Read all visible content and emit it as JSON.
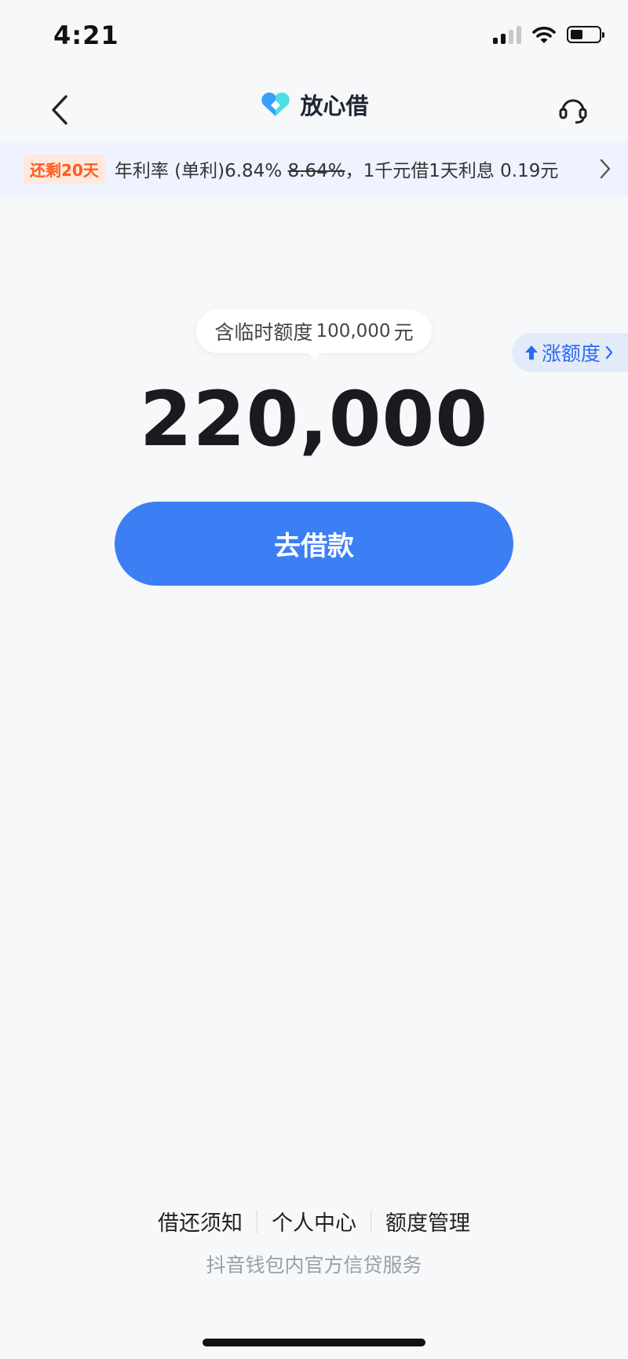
{
  "status_bar": {
    "time": "4:21",
    "battery_level": 0.45
  },
  "nav": {
    "brand_name": "放心借",
    "brand_colors": {
      "left": "#3aa0ff",
      "right": "#4be0e6",
      "center": "#ffffff"
    }
  },
  "promo": {
    "tag": "还剩20天",
    "rate_prefix": "年利率 (单利)",
    "rate_current": "6.84%",
    "rate_original": "8.64%",
    "rate_suffix": "，1千元借1天利息 0.19元"
  },
  "credit": {
    "temp_prefix": "含临时额度",
    "temp_amount": "100,000",
    "temp_unit": "元",
    "amount": "220,000",
    "raise_label": "涨额度"
  },
  "actions": {
    "borrow_label": "去借款"
  },
  "footer": {
    "links": [
      "借还须知",
      "个人中心",
      "额度管理"
    ],
    "note": "抖音钱包内官方信贷服务"
  },
  "colors": {
    "accent": "#3c7ff5",
    "promo_tag": "#ff5a1f",
    "background": "#f7f8fa"
  }
}
